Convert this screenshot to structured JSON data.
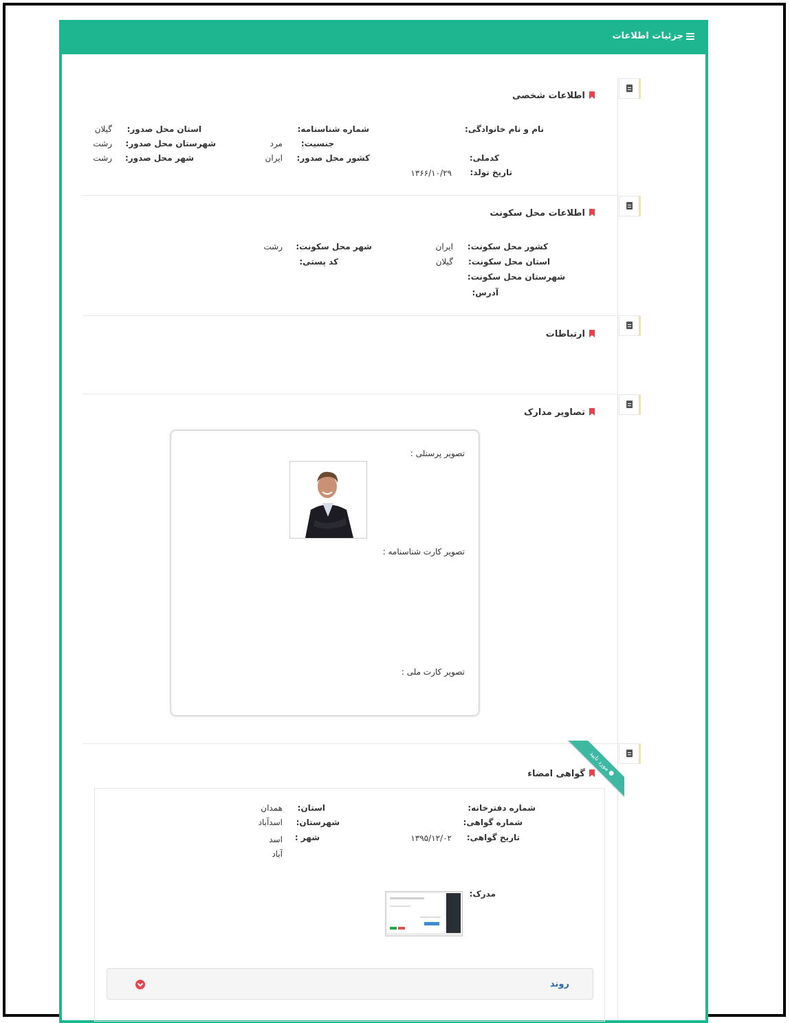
{
  "panel": {
    "title": "جزئیات اطلاعات"
  },
  "personal": {
    "title": "اطلاعات شخصی",
    "fields": {
      "full_name_label": "نام و نام خانوادگی:",
      "national_code_label": "کدملی:",
      "birth_date_label": "تاریخ تولد:",
      "birth_date_value": "۱۳۶۶/۱۰/۲۹",
      "id_number_label": "شماره شناسنامه:",
      "gender_label": "جنسیت:",
      "gender_value": "مرد",
      "issue_country_label": "کشور محل صدور:",
      "issue_country_value": "ایران",
      "issue_province_label": "استان محل صدور:",
      "issue_province_value": "گیلان",
      "issue_county_label": "شهرستان محل صدور:",
      "issue_county_value": "رشت",
      "issue_city_label": "شهر محل صدور:",
      "issue_city_value": "رشت"
    }
  },
  "residence": {
    "title": "اطلاعات محل سکونت",
    "fields": {
      "country_label": "کشور محل سکونت:",
      "country_value": "ایران",
      "province_label": "استان محل سکونت:",
      "province_value": "گیلان",
      "county_label": "شهرستان محل سکونت:",
      "address_label": "آدرس:",
      "city_label": "شهر محل سکونت:",
      "city_value": "رشت",
      "postal_label": "کد پستی:"
    }
  },
  "contacts": {
    "title": "ارتباطات"
  },
  "documents": {
    "title": "تصاویر مدارک",
    "personal_photo_label": "تصویر پرسنلی :",
    "id_card_label": "تصویر کارت شناسنامه :",
    "national_card_label": "تصویر کارت ملی :"
  },
  "signature": {
    "title": "گواهی امضاء",
    "ribbon": "مورد تایید",
    "fields": {
      "office_number_label": "شماره دفترخانه:",
      "cert_number_label": "شماره گواهی:",
      "cert_date_label": "تاریخ گواهی:",
      "cert_date_value": "۱۳۹۵/۱۲/۰۲",
      "province_label": "استان:",
      "province_value": "همدان",
      "county_label": "شهرستان:",
      "county_value": "اسدآباد",
      "city_label": "شهر :",
      "city_value": "اسد آباد",
      "document_label": "مدرک:"
    },
    "process_label": "روند"
  },
  "colors": {
    "accent": "#1eb591",
    "bookmark": "#e8434b",
    "ribbon": "#3fb8a3"
  }
}
